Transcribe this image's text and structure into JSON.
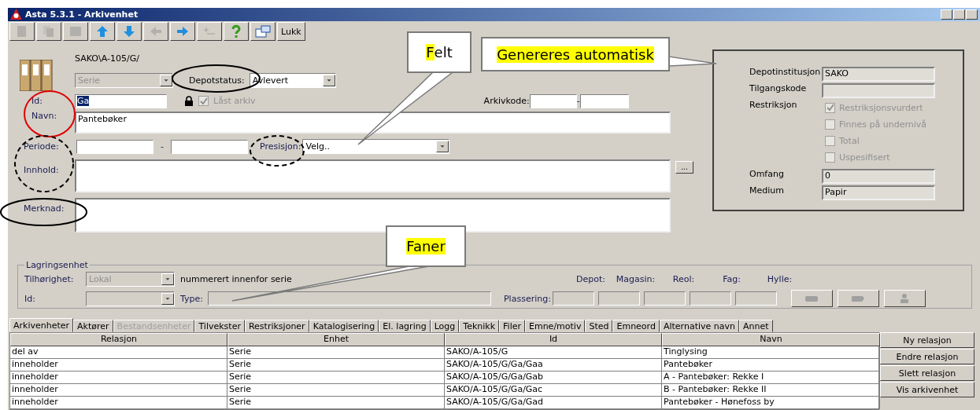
{
  "window": {
    "title": "Asta 5.3.1 - Arkivenhet"
  },
  "toolbar": [
    {
      "kind": "new",
      "disabled": true
    },
    {
      "kind": "copy",
      "disabled": true
    },
    {
      "kind": "save",
      "disabled": true
    },
    {
      "kind": "up",
      "disabled": false
    },
    {
      "kind": "down",
      "disabled": false
    },
    {
      "kind": "back",
      "disabled": true
    },
    {
      "kind": "forward",
      "disabled": false
    },
    {
      "kind": "add",
      "disabled": true
    },
    {
      "kind": "help",
      "disabled": false
    },
    {
      "kind": "settings",
      "disabled": false
    },
    {
      "kind": "text",
      "label": "Lukk",
      "disabled": false
    }
  ],
  "header": {
    "path": "SAKO\\A-105/G/",
    "type": {
      "value": "Serie",
      "disabled": true
    },
    "depotstatus": {
      "label": "Depotstatus:",
      "value": "Avlevert"
    }
  },
  "fields": {
    "id": {
      "label": "Id:",
      "value": "Ga",
      "selected": true
    },
    "locked": {
      "label": "Låst arkiv",
      "checked": true,
      "disabled": true
    },
    "navn": {
      "label": "Navn:",
      "value": "Pantebøker"
    },
    "arkivkode": {
      "label": "Arkivkode:",
      "separator": "-"
    },
    "periode": {
      "label": "Periode:",
      "separator": "-"
    },
    "presisjon": {
      "label": "Presisjon:",
      "value": "Velg.."
    },
    "innhold": {
      "label": "Innhold:",
      "button": "..."
    },
    "merknad": {
      "label": "Merknad:"
    }
  },
  "panel": {
    "depotinstitusjon": {
      "label": "Depotinstitusjon",
      "value": "SAKO"
    },
    "tilgangskode": {
      "label": "Tilgangskode"
    },
    "restriksjon": {
      "label": "Restriksjon",
      "options": [
        {
          "label": "Restriksjonsvurdert",
          "checked": true,
          "disabled": true
        },
        {
          "label": "Finnes på undernivå",
          "checked": false,
          "disabled": true
        },
        {
          "label": "Total",
          "checked": false,
          "disabled": true
        },
        {
          "label": "Uspesifisert",
          "checked": false,
          "disabled": true
        }
      ]
    },
    "omfang": {
      "label": "Omfang",
      "value": "0"
    },
    "medium": {
      "label": "Medium",
      "value": "Papir"
    }
  },
  "storage": {
    "legend": "Lagringsenhet",
    "tilhorighet": {
      "label": "Tilhørighet:",
      "value": "Lokal",
      "disabled": true
    },
    "note": "nummerert innenfor serie",
    "id": {
      "label": "Id:",
      "disabled": true
    },
    "type": {
      "label": "Type:"
    },
    "plassering": {
      "label": "Plassering:",
      "columns": [
        "Depot:",
        "Magasin:",
        "Reol:",
        "Fag:",
        "Hylle:"
      ]
    },
    "buttons": [
      {
        "kind": "link",
        "disabled": true
      },
      {
        "kind": "move",
        "disabled": true
      },
      {
        "kind": "person",
        "disabled": true
      }
    ]
  },
  "tabs": [
    {
      "label": "Arkivenheter",
      "selected": true,
      "disabled": false
    },
    {
      "label": "Aktører",
      "selected": false,
      "disabled": false
    },
    {
      "label": "Bestandsenheter",
      "selected": false,
      "disabled": true
    },
    {
      "label": "Tilvekster",
      "selected": false,
      "disabled": false
    },
    {
      "label": "Restriksjoner",
      "selected": false,
      "disabled": false
    },
    {
      "label": "Katalogisering",
      "selected": false,
      "disabled": false
    },
    {
      "label": "El. lagring",
      "selected": false,
      "disabled": false
    },
    {
      "label": "Logg",
      "selected": false,
      "disabled": false
    },
    {
      "label": "Teknikk",
      "selected": false,
      "disabled": false
    },
    {
      "label": "Filer",
      "selected": false,
      "disabled": false
    },
    {
      "label": "Emne/motiv",
      "selected": false,
      "disabled": false
    },
    {
      "label": "Sted",
      "selected": false,
      "disabled": false
    },
    {
      "label": "Emneord",
      "selected": false,
      "disabled": false
    },
    {
      "label": "Alternative navn",
      "selected": false,
      "disabled": false
    },
    {
      "label": "Annet",
      "selected": false,
      "disabled": false
    }
  ],
  "table": {
    "columns": [
      "Relasjon",
      "Enhet",
      "Id",
      "Navn"
    ],
    "rows": [
      [
        "del av",
        "Serie",
        "SAKO/A-105/G",
        "Tinglysing"
      ],
      [
        "inneholder",
        "Serie",
        "SAKO/A-105/G/Ga/Gaa",
        "Pantebøker"
      ],
      [
        "inneholder",
        "Serie",
        "SAKO/A-105/G/Ga/Gab",
        "A - Pantebøker: Rekke I"
      ],
      [
        "inneholder",
        "Serie",
        "SAKO/A-105/G/Ga/Gac",
        "B - Pantebøker:  Rekke II"
      ],
      [
        "inneholder",
        "Serie",
        "SAKO/A-105/G/Ga/Gad",
        "Pantebøker - Hønefoss by"
      ]
    ]
  },
  "side_buttons": [
    "Ny relasjon",
    "Endre relasjon",
    "Slett relasjon",
    "Vis arkivenhet"
  ],
  "annotations": {
    "callouts": [
      {
        "highlight": "F",
        "rest": "elt"
      },
      {
        "highlight": "Genereres automatisk"
      },
      {
        "highlight": "Faner"
      }
    ],
    "ellipses": [
      {
        "color": "#e00000",
        "dashed": false
      },
      {
        "color": "#000000",
        "dashed": false
      },
      {
        "color": "#000000",
        "dashed": true
      },
      {
        "color": "#000000",
        "dashed": true
      },
      {
        "color": "#000000",
        "dashed": false
      }
    ]
  }
}
